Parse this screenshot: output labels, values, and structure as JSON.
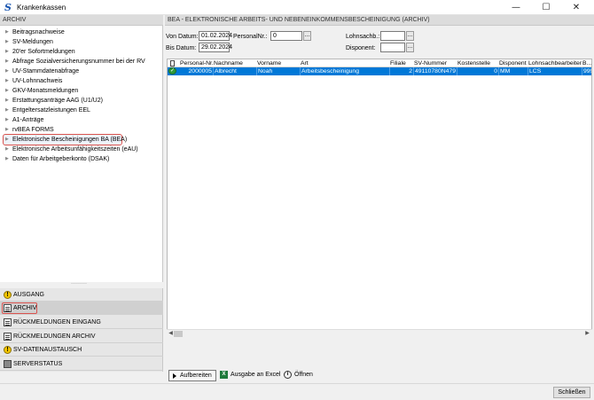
{
  "window": {
    "title": "Krankenkassen",
    "app_icon": "S",
    "minimize": "—",
    "maximize": "☐",
    "close": "✕"
  },
  "left": {
    "header": "ARCHIV",
    "tree": [
      "Beitragsnachweise",
      "SV-Meldungen",
      "20'er Sofortmeldungen",
      "Abfrage Sozialversicherungsnummer bei der RV",
      "UV-Stammdatenabfrage",
      "UV-Lohnnachweis",
      "GKV-Monatsmeldungen",
      "Erstattungsanträge AAG (U1/U2)",
      "Entgeltersatzleistungen EEL",
      "A1-Anträge",
      "rvBEA FORMS",
      "Elektronische Bescheinigungen BA (BEA)",
      "Elektronische Arbeitsunfähigkeitszeiten (eAU)",
      "Daten für Arbeitgeberkonto (DSAK)"
    ],
    "selected_index": 11,
    "nav": [
      {
        "label": "AUSGANG",
        "icon": "warning-icon"
      },
      {
        "label": "ARCHIV",
        "icon": "document-icon"
      },
      {
        "label": "RÜCKMELDUNGEN EINGANG",
        "icon": "document-icon"
      },
      {
        "label": "RÜCKMELDUNGEN ARCHIV",
        "icon": "document-icon"
      },
      {
        "label": "SV-DATENAUSTAUSCH",
        "icon": "warning-icon"
      },
      {
        "label": "SERVERSTATUS",
        "icon": "server-icon"
      }
    ]
  },
  "right": {
    "header": "BEA - ELEKTRONISCHE ARBEITS- UND NEBENEINKOMMENSBESCHEINIGUNG (ARCHIV)",
    "filter": {
      "von_label": "Von Datum:",
      "von_value": "01.02.2024",
      "bis_label": "Bis Datum:",
      "bis_value": "29.02.2024",
      "personalnr_label": "PersonalNr.:",
      "personalnr_value": "0",
      "lohnsachb_label": "Lohnsachb.:",
      "lohnsachb_value": "",
      "disponent_label": "Disponent:",
      "disponent_value": "",
      "lookup": "..."
    },
    "grid": {
      "columns": [
        "Personal-Nr.",
        "Nachname",
        "Vorname",
        "Art",
        "Filiale",
        "SV-Nummer",
        "Kostenstelle",
        "Disponent",
        "Lohnsachbearbeiter",
        "B..."
      ],
      "rows": [
        [
          "2000005",
          "Albrecht",
          "Noah",
          "Arbeitsbescheinigung",
          "2",
          "49110780N479",
          "0",
          "MM",
          "LCS",
          "999"
        ]
      ]
    },
    "actions": {
      "aufbereiten": "Aufbereiten",
      "excel": "Ausgabe an Excel",
      "oeffnen": "Öffnen"
    }
  },
  "footer": {
    "close_label": "Schließen"
  }
}
